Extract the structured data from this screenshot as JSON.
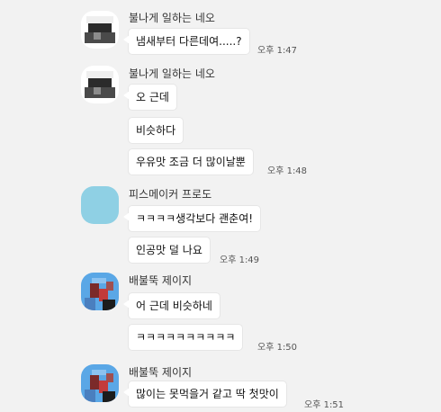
{
  "groups": [
    {
      "sender": "불나게 일하는 네오",
      "avatar_icon": "neo-avatar",
      "messages": [
        {
          "text": "냄새부터 다른데여.....?",
          "time": "오후 1:47"
        }
      ]
    },
    {
      "sender": "불나게 일하는 네오",
      "avatar_icon": "neo-avatar",
      "messages": [
        {
          "text": "오 근데",
          "time": ""
        },
        {
          "text": "비슷하다",
          "time": ""
        },
        {
          "text": "우유맛 조금 더 많이날뿐",
          "time": "오후 1:48"
        }
      ]
    },
    {
      "sender": "피스메이커 프로도",
      "avatar_icon": "frodo-avatar",
      "messages": [
        {
          "text": "ㅋㅋㅋㅋ생각보다 괜춘여!",
          "time": ""
        },
        {
          "text": "인공맛 덜 나요",
          "time": "오후 1:49"
        }
      ]
    },
    {
      "sender": "배불뚝 제이지",
      "avatar_icon": "jayg-avatar",
      "messages": [
        {
          "text": "어 근데 비슷하네",
          "time": ""
        },
        {
          "text": "ㅋㅋㅋㅋㅋㅋㅋㅋㅋㅋ",
          "time": "오후 1:50"
        }
      ]
    },
    {
      "sender": "배불뚝 제이지",
      "avatar_icon": "jayg-avatar",
      "messages": [
        {
          "text": "많이는 못먹을거 같고 딱 첫맛이",
          "time": "오후 1:51"
        }
      ]
    }
  ],
  "colors": {
    "background": "#f2f2f2",
    "bubble": "#ffffff",
    "frodo_avatar": "#8fd0e4",
    "jayg_avatar": "#5aa7e6"
  }
}
